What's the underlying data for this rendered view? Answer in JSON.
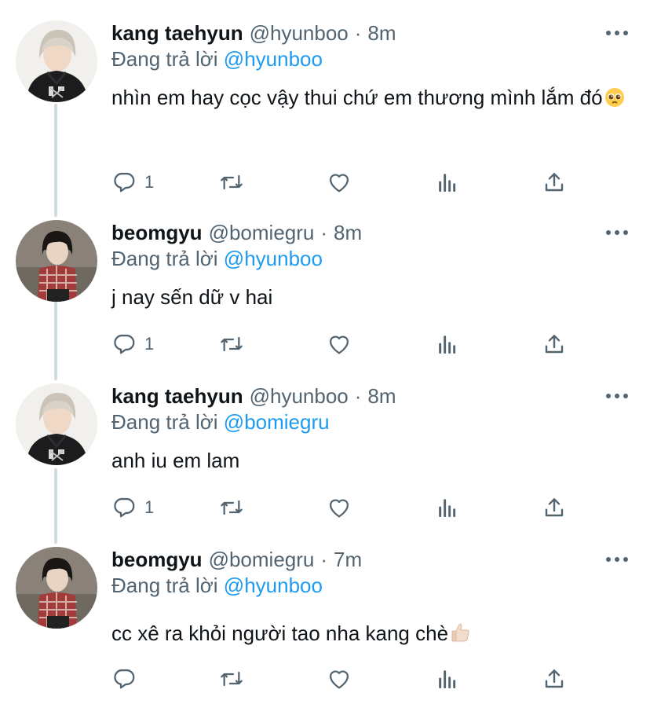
{
  "tweets": [
    {
      "name": "kang taehyun",
      "handle": "@hyunboo",
      "dot": "·",
      "time": "8m",
      "replying_prefix": "Đang trả lời",
      "replying_to": "@hyunboo",
      "text": "nhìn em hay cọc vậy thui chứ em thương mình lắm đó",
      "emoji": "pleading-face",
      "reply_count": "1"
    },
    {
      "name": "beomgyu",
      "handle": "@bomiegru",
      "dot": "·",
      "time": "8m",
      "replying_prefix": "Đang trả lời",
      "replying_to": "@hyunboo",
      "text": "j nay sến dữ v hai",
      "reply_count": "1"
    },
    {
      "name": "kang taehyun",
      "handle": "@hyunboo",
      "dot": "·",
      "time": "8m",
      "replying_prefix": "Đang trả lời",
      "replying_to": "@bomiegru",
      "text": "anh iu em lam",
      "reply_count": "1"
    },
    {
      "name": "beomgyu",
      "handle": "@bomiegru",
      "dot": "·",
      "time": "7m",
      "replying_prefix": "Đang trả lời",
      "replying_to": "@hyunboo",
      "text": "cc xê ra khỏi người tao nha kang chè",
      "emoji": "thumbs-up",
      "reply_count": ""
    }
  ],
  "icons": {
    "reply": "comment-icon",
    "retweet": "retweet-icon",
    "like": "heart-icon",
    "views": "views-icon",
    "share": "share-icon",
    "more": "more-icon"
  },
  "colors": {
    "link": "#1d9bf0",
    "secondary": "#536471",
    "text": "#0f1419",
    "thread_line": "#cfd9de"
  }
}
